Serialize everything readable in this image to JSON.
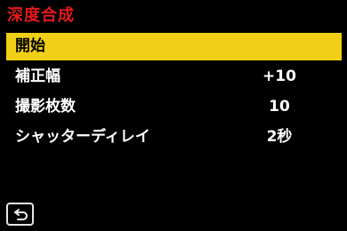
{
  "screen": {
    "title": "深度合成"
  },
  "menu": {
    "items": [
      {
        "label": "開始",
        "value": "",
        "selected": true
      },
      {
        "label": "補正幅",
        "value": "+10",
        "selected": false
      },
      {
        "label": "撮影枚数",
        "value": "10",
        "selected": false
      },
      {
        "label": "シャッターディレイ",
        "value": "2秒",
        "selected": false
      }
    ]
  },
  "footer": {
    "back_icon": "return-arrow-icon"
  },
  "colors": {
    "background": "#000000",
    "title": "#e2191b",
    "highlight": "#f0cf16",
    "text": "#ffffff",
    "selected_text": "#000000"
  }
}
